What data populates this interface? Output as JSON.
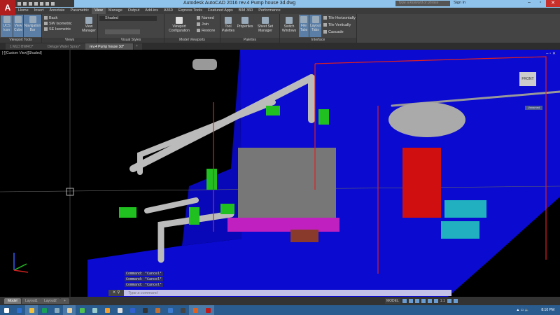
{
  "app": {
    "title": "Autodesk AutoCAD 2016   rev.4 Pump house 3d.dwg",
    "logo": "A",
    "search_placeholder": "Type a keyword or phrase",
    "sign_in": "Sign In"
  },
  "ribbon_tabs": [
    "Home",
    "Insert",
    "Annotate",
    "Parametric",
    "View",
    "Manage",
    "Output",
    "Add-ins",
    "A360",
    "Express Tools",
    "Featured Apps",
    "BIM 360",
    "Performance"
  ],
  "active_tab": "View",
  "panels": {
    "viewport_tools": {
      "label": "Viewport Tools",
      "buttons": [
        "UCS Icon",
        "View Cube",
        "Navigation Bar"
      ]
    },
    "views": {
      "label": "Views",
      "items": [
        "Back",
        "SW Isometric",
        "SE Isometric"
      ],
      "view_manager": "View Manager"
    },
    "visual_styles": {
      "label": "Visual Styles",
      "selected": "Shaded"
    },
    "model_viewports": {
      "label": "Model Viewports",
      "config": "Viewport Configuration",
      "items": [
        "Named",
        "Join",
        "Restore"
      ]
    },
    "palettes": {
      "label": "Palettes",
      "buttons": [
        "Tool Palettes",
        "Properties",
        "Sheet Set Manager"
      ]
    },
    "interface": {
      "label": "Interface",
      "buttons": [
        "Switch Windows",
        "File Tabs",
        "Layout Tabs"
      ],
      "items": [
        "Tile Horizontally",
        "Tile Vertically",
        "Cascade"
      ]
    }
  },
  "file_tabs": [
    "1 MLD BWRO*",
    "Deluge Water Spray*",
    "rev.4 Pump house 3d*"
  ],
  "active_file": "rev.4 Pump house 3d*",
  "viewport": {
    "label": "[-][Custom View][Shaded]",
    "viewcube_face": "FRONT",
    "viewcube_menu": "Unnamed"
  },
  "command": {
    "history": [
      "Command: *Cancel*",
      "Command: *Cancel*",
      "Command: *Cancel*"
    ],
    "placeholder": "Type a command"
  },
  "layout_tabs": [
    "Model",
    "Layout1",
    "Layout2"
  ],
  "status": {
    "model": "MODEL",
    "scale": "1:1"
  },
  "taskbar": {
    "time": "8:10 PM",
    "apps": [
      "#2d6fd0",
      "#f0c040",
      "#18a058",
      "#8ab",
      "#e8d0a0",
      "#50c050",
      "#9cc",
      "#f0a030",
      "#ddd",
      "#3060d0",
      "#333",
      "#c07030",
      "#3a7ad0",
      "#444",
      "#e06020",
      "#c01818"
    ]
  },
  "colors": {
    "title_bar": "#8fc3ec",
    "ribbon": "#444444",
    "viewport_bg": "#000000",
    "floor_blue": "#0a0ad0",
    "taskbar": "#2a5c8f"
  }
}
